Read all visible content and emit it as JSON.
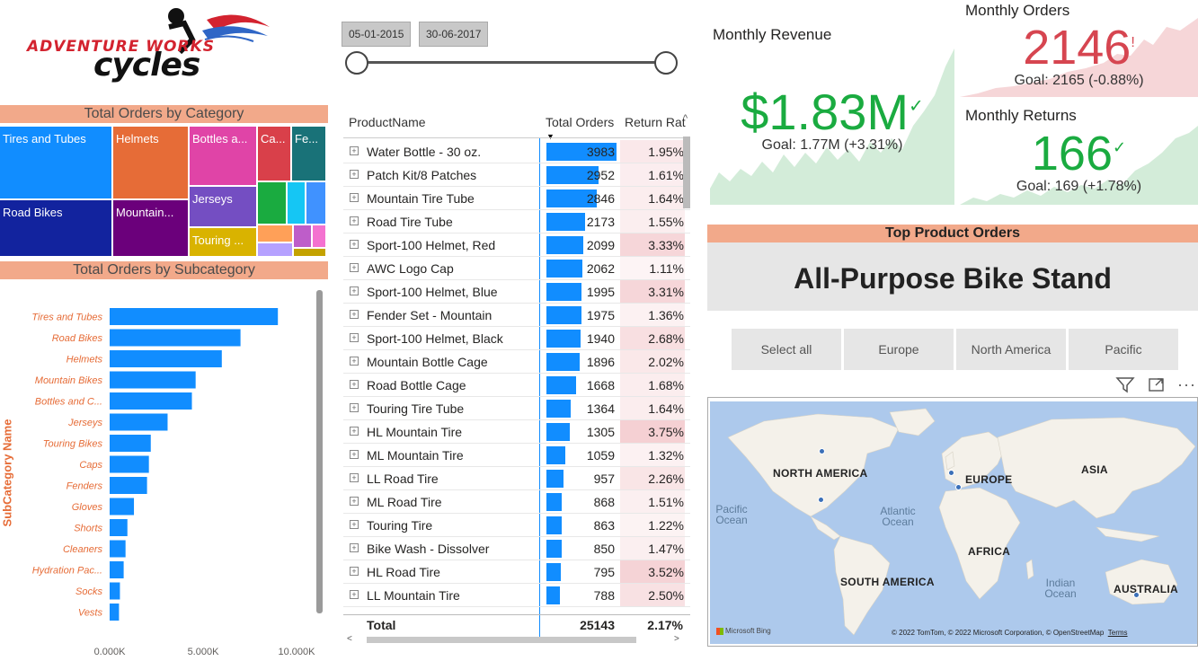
{
  "logo": {
    "line1": "ADVENTURE WORKS",
    "line2": "cycles"
  },
  "category": {
    "title": "Total Orders by Category",
    "tiles": [
      "Tires and Tubes",
      "Helmets",
      "Bottles a...",
      "Ca...",
      "Fe...",
      "Road Bikes",
      "Mountain...",
      "Jerseys",
      "Touring ..."
    ]
  },
  "subcategory": {
    "title": "Total Orders by Subcategory",
    "ylabel": "SubCategory Name",
    "xticks": [
      "0.000K",
      "5.000K",
      "10.000K"
    ]
  },
  "chart_data": {
    "type": "bar",
    "orientation": "horizontal",
    "title": "Total Orders by Subcategory",
    "ylabel": "SubCategory Name",
    "xlim": [
      0,
      10000
    ],
    "categories": [
      "Tires and Tubes",
      "Road Bikes",
      "Helmets",
      "Mountain Bikes",
      "Bottles and C...",
      "Jerseys",
      "Touring Bikes",
      "Caps",
      "Fenders",
      "Gloves",
      "Shorts",
      "Cleaners",
      "Hydration Pac...",
      "Socks",
      "Vests"
    ],
    "values": [
      9000,
      7000,
      6000,
      4600,
      4400,
      3100,
      2200,
      2100,
      2000,
      1300,
      950,
      850,
      750,
      550,
      500
    ],
    "color": "#118dff"
  },
  "dates": {
    "start": "05-01-2015",
    "end": "30-06-2017"
  },
  "table": {
    "headers": {
      "name": "ProductName",
      "orders": "Total Orders",
      "return": "Return Rat"
    },
    "max_orders": 3983,
    "rows": [
      {
        "name": "Water Bottle - 30 oz.",
        "orders": "3983",
        "rate": "1.95%",
        "v": 3983,
        "r": 1.95
      },
      {
        "name": "Patch Kit/8 Patches",
        "orders": "2952",
        "rate": "1.61%",
        "v": 2952,
        "r": 1.61
      },
      {
        "name": "Mountain Tire Tube",
        "orders": "2846",
        "rate": "1.64%",
        "v": 2846,
        "r": 1.64
      },
      {
        "name": "Road Tire Tube",
        "orders": "2173",
        "rate": "1.55%",
        "v": 2173,
        "r": 1.55
      },
      {
        "name": "Sport-100 Helmet, Red",
        "orders": "2099",
        "rate": "3.33%",
        "v": 2099,
        "r": 3.33
      },
      {
        "name": "AWC Logo Cap",
        "orders": "2062",
        "rate": "1.11%",
        "v": 2062,
        "r": 1.11
      },
      {
        "name": "Sport-100 Helmet, Blue",
        "orders": "1995",
        "rate": "3.31%",
        "v": 1995,
        "r": 3.31
      },
      {
        "name": "Fender Set - Mountain",
        "orders": "1975",
        "rate": "1.36%",
        "v": 1975,
        "r": 1.36
      },
      {
        "name": "Sport-100 Helmet, Black",
        "orders": "1940",
        "rate": "2.68%",
        "v": 1940,
        "r": 2.68
      },
      {
        "name": "Mountain Bottle Cage",
        "orders": "1896",
        "rate": "2.02%",
        "v": 1896,
        "r": 2.02
      },
      {
        "name": "Road Bottle Cage",
        "orders": "1668",
        "rate": "1.68%",
        "v": 1668,
        "r": 1.68
      },
      {
        "name": "Touring Tire Tube",
        "orders": "1364",
        "rate": "1.64%",
        "v": 1364,
        "r": 1.64
      },
      {
        "name": "HL Mountain Tire",
        "orders": "1305",
        "rate": "3.75%",
        "v": 1305,
        "r": 3.75
      },
      {
        "name": "ML Mountain Tire",
        "orders": "1059",
        "rate": "1.32%",
        "v": 1059,
        "r": 1.32
      },
      {
        "name": "LL Road Tire",
        "orders": "957",
        "rate": "2.26%",
        "v": 957,
        "r": 2.26
      },
      {
        "name": "ML Road Tire",
        "orders": "868",
        "rate": "1.51%",
        "v": 868,
        "r": 1.51
      },
      {
        "name": "Touring Tire",
        "orders": "863",
        "rate": "1.22%",
        "v": 863,
        "r": 1.22
      },
      {
        "name": "Bike Wash - Dissolver",
        "orders": "850",
        "rate": "1.47%",
        "v": 850,
        "r": 1.47
      },
      {
        "name": "HL Road Tire",
        "orders": "795",
        "rate": "3.52%",
        "v": 795,
        "r": 3.52
      },
      {
        "name": "LL Mountain Tire",
        "orders": "788",
        "rate": "2.50%",
        "v": 788,
        "r": 2.5
      }
    ],
    "total_label": "Total",
    "total_orders": "25143",
    "total_rate": "2.17%"
  },
  "kpi": {
    "revenue": {
      "title": "Monthly Revenue",
      "value": "$1.83M",
      "goal": "Goal: 1.77M (+3.31%)",
      "status": "good"
    },
    "orders": {
      "title": "Monthly Orders",
      "value": "2146",
      "goal": "Goal: 2165 (-0.88%)",
      "status": "bad"
    },
    "returns": {
      "title": "Monthly Returns",
      "value": "166",
      "goal": "Goal: 169 (+1.78%)",
      "status": "good"
    }
  },
  "colors": {
    "good": "#1aab40",
    "bad": "#d64550",
    "good_fill": "#d3ecd9",
    "bad_fill": "#f6d6d8"
  },
  "top_product": {
    "title": "Top Product Orders",
    "value": "All-Purpose Bike Stand"
  },
  "regions": [
    "Select all",
    "Europe",
    "North America",
    "Pacific"
  ],
  "map": {
    "continents": [
      "NORTH AMERICA",
      "EUROPE",
      "ASIA",
      "AFRICA",
      "SOUTH AMERICA",
      "AUSTRALIA"
    ],
    "oceans": [
      "Pacific Ocean",
      "Atlantic Ocean",
      "Indian Ocean"
    ],
    "brand": "Microsoft Bing",
    "credit": "© 2022 TomTom, © 2022 Microsoft Corporation, © OpenStreetMap",
    "terms": "Terms"
  }
}
